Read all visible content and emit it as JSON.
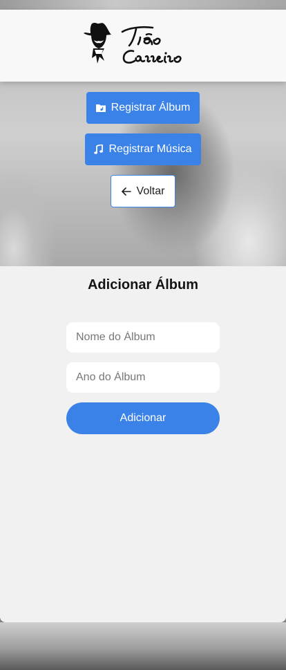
{
  "brand": {
    "logo_text": "Tião Carreiro"
  },
  "nav": {
    "register_album_label": "Registrar Álbum",
    "register_song_label": "Registrar Música",
    "back_label": "Voltar"
  },
  "form": {
    "title": "Adicionar Álbum",
    "album_name_placeholder": "Nome do Álbum",
    "album_year_placeholder": "Ano do Álbum",
    "submit_label": "Adicionar"
  },
  "colors": {
    "primary": "#3b82e8",
    "panel_bg": "#f1f1f1",
    "header_bg": "#f8f8f8"
  },
  "icons": {
    "register_album": "album-folder-icon",
    "register_song": "music-note-icon",
    "back": "arrow-left-icon"
  }
}
